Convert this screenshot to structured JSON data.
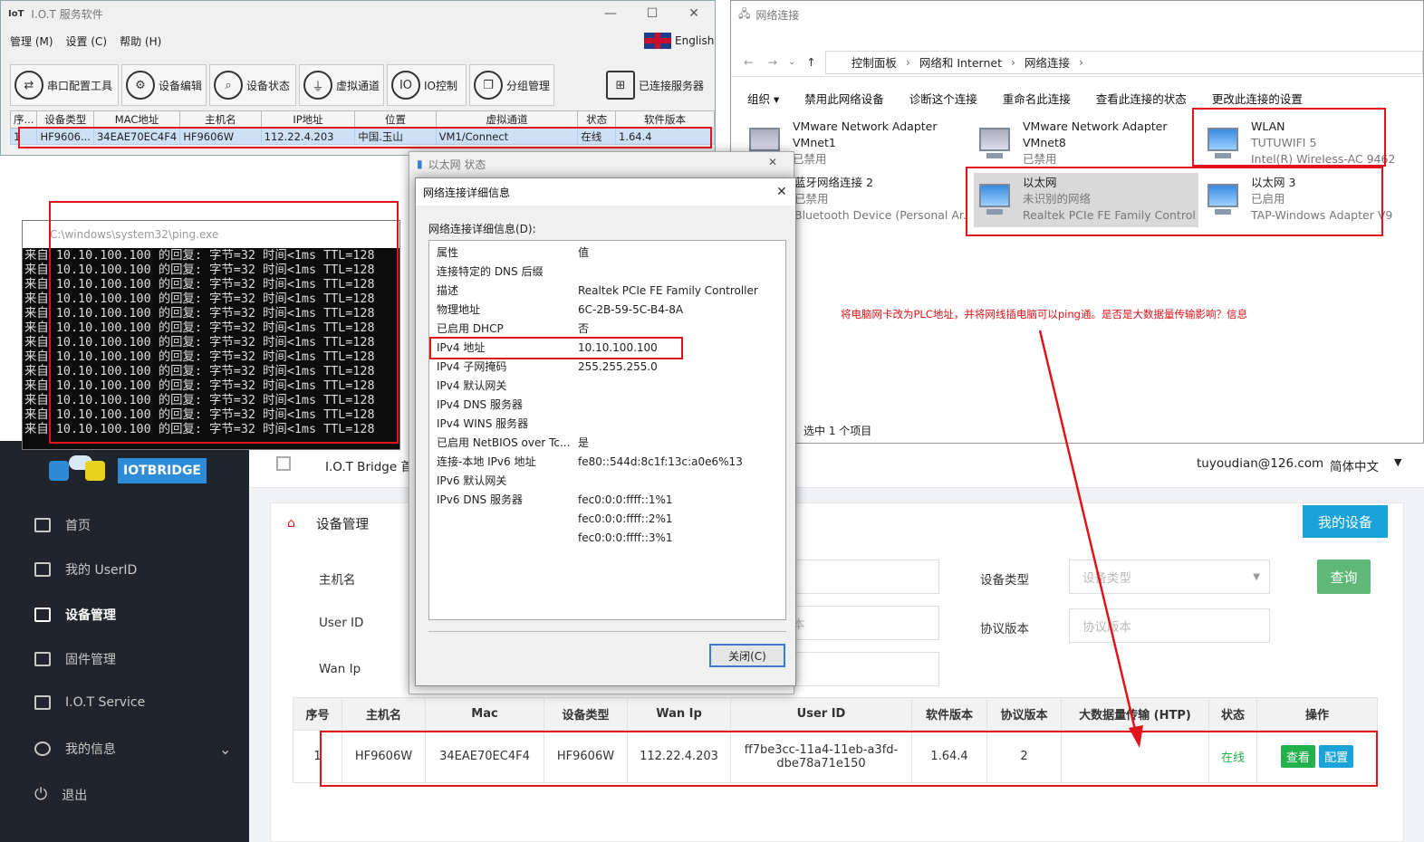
{
  "iot": {
    "title": "I.O.T 服务软件",
    "menu": [
      "管理 (M)",
      "设置 (C)",
      "帮助 (H)"
    ],
    "language": "English",
    "toolbar": [
      "串口配置工具",
      "设备编辑",
      "设备状态",
      "虚拟通道",
      "IO控制",
      "分组管理",
      "已连接服务器"
    ],
    "columns": [
      "序...",
      "设备类型",
      "MAC地址",
      "主机名",
      "IP地址",
      "位置",
      "虚拟通道",
      "状态",
      "软件版本"
    ],
    "row": [
      "1",
      "HF9606...",
      "34EAE70EC4F4",
      "HF9606W",
      "112.22.4.203",
      "中国.玉山",
      "VM1/Connect",
      "在线",
      "1.64.4"
    ]
  },
  "net": {
    "title": "网络连接",
    "breadcrumb": [
      "控制面板",
      "网络和 Internet",
      "网络连接"
    ],
    "commands": [
      "组织 ▾",
      "禁用此网络设备",
      "诊断这个连接",
      "重命名此连接",
      "查看此连接的状态",
      "更改此连接的设置"
    ],
    "adapters": [
      {
        "name": "VMware Network Adapter VMnet1",
        "status": "已禁用",
        "device": ""
      },
      {
        "name": "VMware Network Adapter VMnet8",
        "status": "已禁用",
        "device": ""
      },
      {
        "name": "WLAN",
        "status": "TUTUWIFI 5",
        "device": "Intel(R) Wireless-AC 9462"
      },
      {
        "name": "蓝牙网络连接 2",
        "status": "已禁用",
        "device": "Bluetooth Device (Personal Ar..."
      },
      {
        "name": "以太网",
        "status": "未识别的网络",
        "device": "Realtek PCIe FE Family Control..."
      },
      {
        "name": "以太网 3",
        "status": "已启用",
        "device": "TAP-Windows Adapter V9"
      }
    ],
    "selected": "选中 1 个项目",
    "annotation": "将电脑网卡改为PLC地址，并将网线插电脑可以ping通。是否是大数据量传输影响？信息"
  },
  "cmd": {
    "title": "C:\\windows\\system32\\ping.exe",
    "line": "来自 10.10.100.100 的回复: 字节=32 时间<1ms TTL=128"
  },
  "eth": {
    "title": "以太网 状态"
  },
  "details": {
    "title": "网络连接详细信息",
    "label": "网络连接详细信息(D):",
    "header": [
      "属性",
      "值"
    ],
    "rows": [
      [
        "连接特定的 DNS 后缀",
        ""
      ],
      [
        "描述",
        "Realtek PCIe FE Family Controller"
      ],
      [
        "物理地址",
        "6C-2B-59-5C-B4-8A"
      ],
      [
        "已启用 DHCP",
        "否"
      ],
      [
        "IPv4 地址",
        "10.10.100.100"
      ],
      [
        "IPv4 子网掩码",
        "255.255.255.0"
      ],
      [
        "IPv4 默认网关",
        ""
      ],
      [
        "IPv4 DNS 服务器",
        ""
      ],
      [
        "IPv4 WINS 服务器",
        ""
      ],
      [
        "已启用 NetBIOS over Tc...",
        "是"
      ],
      [
        "连接-本地 IPv6 地址",
        "fe80::544d:8c1f:13c:a0e6%13"
      ],
      [
        "IPv6 默认网关",
        ""
      ],
      [
        "IPv6 DNS 服务器",
        "fec0:0:0:ffff::1%1"
      ],
      [
        "",
        "fec0:0:0:ffff::2%1"
      ],
      [
        "",
        "fec0:0:0:ffff::3%1"
      ]
    ],
    "close": "关闭(C)"
  },
  "web": {
    "logo": "IOTBRIDGE",
    "site_title": "I.O.T Bridge 首",
    "user": "tuyoudian@126.com",
    "lang": "简体中文",
    "nav": [
      "首页",
      "我的 UserID",
      "设备管理",
      "固件管理",
      "I.O.T Service",
      "我的信息",
      "退出"
    ],
    "panel_title": "设备管理",
    "tab": "我的设备",
    "labels": [
      "主机名",
      "User ID",
      "Wan Ip",
      "设备类型",
      "协议版本"
    ],
    "placeholders": {
      "device_type": "设备类型",
      "protocol": "协议版本",
      "partial": "本"
    },
    "query": "查询",
    "columns": [
      "序号",
      "主机名",
      "Mac",
      "设备类型",
      "Wan Ip",
      "User ID",
      "软件版本",
      "协议版本",
      "大数据量传输 (HTP)",
      "状态",
      "操作"
    ],
    "row": [
      "1",
      "HF9606W",
      "34EAE70EC4F4",
      "HF9606W",
      "112.22.4.203",
      "ff7be3cc-11a4-11eb-a3fd-dbe78a71e150",
      "1.64.4",
      "2",
      "",
      "在线"
    ],
    "actions": [
      "查看",
      "配置"
    ]
  },
  "colors": {
    "red": "#e0141a",
    "green": "#22b14c",
    "blue": "#1aa3d9",
    "sidebar": "#20242c"
  }
}
